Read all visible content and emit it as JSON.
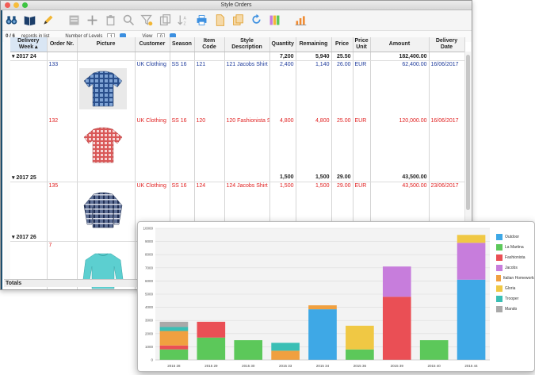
{
  "window": {
    "title": "Style Orders"
  },
  "toolbar": {
    "icons": [
      "binoculars-icon",
      "book-icon",
      "pencil-icon",
      "new-record-icon",
      "plus-icon",
      "trash-icon",
      "search-icon",
      "filter-icon",
      "duplicate-icon",
      "sort-icon",
      "print-icon",
      "document-icon",
      "copy-icon",
      "refresh-icon",
      "columns-icon",
      "chart-icon"
    ]
  },
  "status": {
    "count": "0 / 6",
    "records_label": "records in list",
    "levels_label": "Number of Levels",
    "levels_value": "1",
    "view_label": "View",
    "view_value": "0"
  },
  "grid": {
    "headers": [
      "Delivery Week",
      "Order Nr.",
      "Picture",
      "Customer",
      "Season",
      "Item Code",
      "Style Description",
      "Quantity",
      "Remaining",
      "Price",
      "Price Unit",
      "Amount",
      "Delivery Date"
    ],
    "groups": [
      {
        "week": "2017 24",
        "quantity": "7,200",
        "remaining": "5,940",
        "price": "25.50",
        "amount": "182,400.00",
        "rows": [
          {
            "order": "133",
            "customer": "UK Clothing",
            "season": "SS 16",
            "item": "121",
            "style": "121 Jacobs Shirt",
            "quantity": "2,400",
            "remaining": "1,140",
            "price": "26.00",
            "unit": "EUR",
            "amount": "62,400.00",
            "date": "16/06/2017",
            "color": "blue"
          },
          {
            "order": "132",
            "customer": "UK Clothing",
            "season": "SS 16",
            "item": "120",
            "style": "120 Fashionista Shirt",
            "quantity": "4,800",
            "remaining": "4,800",
            "price": "25.00",
            "unit": "EUR",
            "amount": "120,000.00",
            "date": "16/06/2017",
            "color": "red"
          }
        ]
      },
      {
        "week": "2017 25",
        "quantity": "1,500",
        "remaining": "1,500",
        "price": "29.00",
        "amount": "43,500.00",
        "rows": [
          {
            "order": "135",
            "customer": "UK Clothing",
            "season": "SS 16",
            "item": "124",
            "style": "124 Jacobs Shirt",
            "quantity": "1,500",
            "remaining": "1,500",
            "price": "29.00",
            "unit": "EUR",
            "amount": "43,500.00",
            "date": "23/06/2017",
            "color": "red"
          }
        ]
      },
      {
        "week": "2017 26",
        "rows": [
          {
            "order": "7",
            "color": "red"
          }
        ]
      }
    ],
    "totals_label": "Totals"
  },
  "colors": {
    "blue_text": "#1f3c9c",
    "red_text": "#e02020"
  },
  "chart_data": {
    "type": "bar",
    "stacked": true,
    "categories": [
      "2015 28",
      "2015 29",
      "2015 30",
      "2015 33",
      "2015 34",
      "2015 36",
      "2015 39",
      "2015 40",
      "2015 44"
    ],
    "ylim": [
      0,
      10000
    ],
    "yticks": [
      "0",
      "1000",
      "2000",
      "3000",
      "4000",
      "5000",
      "6000",
      "7000",
      "8000",
      "9000",
      "10000"
    ],
    "series": [
      {
        "name": "Outdoor",
        "color": "#3ea8e6",
        "values": [
          0,
          0,
          0,
          0,
          3850,
          0,
          0,
          0,
          6100
        ]
      },
      {
        "name": "La Martina",
        "color": "#5cc85a",
        "values": [
          800,
          1700,
          1500,
          0,
          0,
          800,
          0,
          1500,
          0
        ]
      },
      {
        "name": "Fashionista",
        "color": "#ea4f55",
        "values": [
          300,
          1200,
          0,
          0,
          0,
          0,
          4800,
          0,
          0
        ]
      },
      {
        "name": "Jacobs",
        "color": "#c77ddc",
        "values": [
          0,
          0,
          0,
          0,
          0,
          0,
          2300,
          0,
          2800
        ]
      },
      {
        "name": "Italian Homeworks",
        "color": "#f0a040",
        "values": [
          1100,
          0,
          0,
          700,
          300,
          0,
          0,
          0,
          0
        ]
      },
      {
        "name": "Gloria",
        "color": "#f0c844",
        "values": [
          0,
          0,
          0,
          0,
          0,
          1800,
          0,
          0,
          600
        ]
      },
      {
        "name": "Trooper",
        "color": "#3abfb5",
        "values": [
          300,
          0,
          0,
          600,
          0,
          0,
          0,
          0,
          0
        ]
      },
      {
        "name": "Mando",
        "color": "#a9a9a9",
        "values": [
          400,
          0,
          0,
          0,
          0,
          0,
          0,
          0,
          0
        ]
      }
    ]
  }
}
